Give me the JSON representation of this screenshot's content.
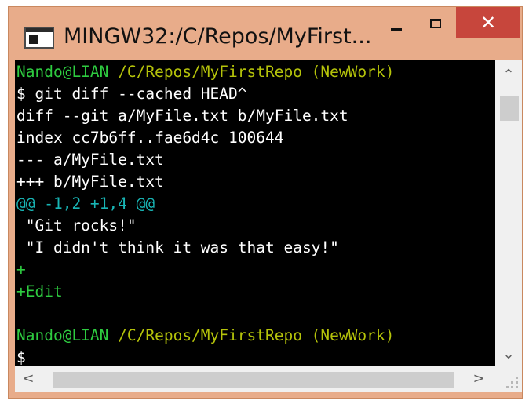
{
  "window": {
    "title": "MINGW32:/C/Repos/MyFirst...",
    "close_label": "✕"
  },
  "icons": {
    "app": "terminal-window-icon",
    "minimize": "minimize-icon",
    "maximize": "maximize-icon",
    "close": "close-icon",
    "scroll_up": "chevron-up-icon",
    "scroll_down": "chevron-down-icon",
    "scroll_left": "chevron-left-icon",
    "scroll_right": "chevron-right-icon",
    "resize": "resize-grip-icon"
  },
  "colors": {
    "titlebar": "#e8ac8a",
    "close_button": "#c7463c",
    "terminal_bg": "#000000",
    "user_host": "#2ecc40",
    "path": "#b5c30a",
    "hunk_header": "#18b5b5",
    "added": "#2ecc40",
    "text": "#ffffff"
  },
  "scroll": {
    "up_glyph": "⌃",
    "down_glyph": "⌄",
    "left_glyph": "<",
    "right_glyph": ">"
  },
  "terminal": {
    "lines": [
      [
        {
          "text": "Nando@LIAN ",
          "color": "#2ecc40"
        },
        {
          "text": "/C/Repos/MyFirstRepo (NewWork)",
          "color": "#b5c30a"
        }
      ],
      [
        {
          "text": "$ git diff --cached HEAD^",
          "color": "#ffffff"
        }
      ],
      [
        {
          "text": "diff --git a/MyFile.txt b/MyFile.txt",
          "color": "#ffffff"
        }
      ],
      [
        {
          "text": "index cc7b6ff..fae6d4c 100644",
          "color": "#ffffff"
        }
      ],
      [
        {
          "text": "--- a/MyFile.txt",
          "color": "#ffffff"
        }
      ],
      [
        {
          "text": "+++ b/MyFile.txt",
          "color": "#ffffff"
        }
      ],
      [
        {
          "text": "@@ -1,2 +1,4 @@",
          "color": "#18b5b5"
        }
      ],
      [
        {
          "text": " \"Git rocks!\"",
          "color": "#ffffff"
        }
      ],
      [
        {
          "text": " \"I didn't think it was that easy!\"",
          "color": "#ffffff"
        }
      ],
      [
        {
          "text": "+",
          "color": "#2ecc40"
        }
      ],
      [
        {
          "text": "+Edit",
          "color": "#2ecc40"
        }
      ],
      [
        {
          "text": "",
          "color": "#ffffff"
        }
      ],
      [
        {
          "text": "Nando@LIAN ",
          "color": "#2ecc40"
        },
        {
          "text": "/C/Repos/MyFirstRepo (NewWork)",
          "color": "#b5c30a"
        }
      ],
      [
        {
          "text": "$",
          "color": "#ffffff"
        }
      ]
    ]
  }
}
